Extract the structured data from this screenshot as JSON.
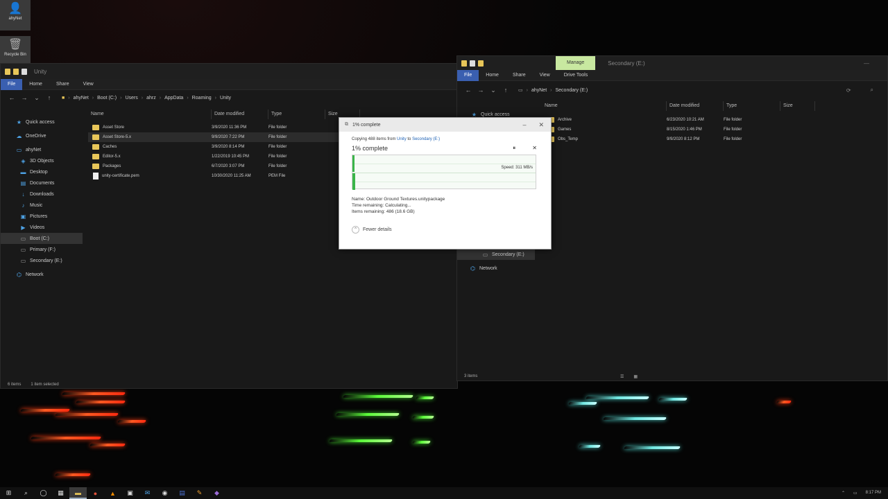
{
  "desktop": {
    "icons": [
      {
        "label": "ahyNet",
        "icon": "user-folder-icon"
      },
      {
        "label": "Recycle Bin",
        "icon": "recycle-bin-icon"
      }
    ]
  },
  "left_window": {
    "title": "Unity",
    "ribbon_tabs": [
      "File",
      "Home",
      "Share",
      "View"
    ],
    "breadcrumb": [
      "ahyNet",
      "Boot (C:)",
      "Users",
      "ahrz",
      "AppData",
      "Roaming",
      "Unity"
    ],
    "columns": [
      "Name",
      "Date modified",
      "Type",
      "Size"
    ],
    "nav": [
      {
        "label": "Quick access",
        "icon": "star"
      },
      {
        "label": "OneDrive",
        "icon": "cloud"
      },
      {
        "label": "ahyNet",
        "icon": "user"
      },
      {
        "label": "3D Objects",
        "icon": "cube"
      },
      {
        "label": "Desktop",
        "icon": "desktop"
      },
      {
        "label": "Documents",
        "icon": "doc"
      },
      {
        "label": "Downloads",
        "icon": "down"
      },
      {
        "label": "Music",
        "icon": "music"
      },
      {
        "label": "Pictures",
        "icon": "pic"
      },
      {
        "label": "Videos",
        "icon": "video"
      },
      {
        "label": "Boot (C:)",
        "icon": "drive"
      },
      {
        "label": "Primary (F:)",
        "icon": "drive"
      },
      {
        "label": "Secondary (E:)",
        "icon": "drive"
      },
      {
        "label": "Network",
        "icon": "network"
      }
    ],
    "files": [
      {
        "name": "Asset Store",
        "date": "3/9/2020 11:36 PM",
        "type": "File folder",
        "kind": "folder"
      },
      {
        "name": "Asset Store-5.x",
        "date": "9/9/2020 7:22 PM",
        "type": "File folder",
        "kind": "folder"
      },
      {
        "name": "Caches",
        "date": "3/9/2020 8:14 PM",
        "type": "File folder",
        "kind": "folder"
      },
      {
        "name": "Editor-5.x",
        "date": "1/22/2019 10:45 PM",
        "type": "File folder",
        "kind": "folder"
      },
      {
        "name": "Packages",
        "date": "6/7/2020 3:07 PM",
        "type": "File folder",
        "kind": "folder"
      },
      {
        "name": "unity-certificate.pem",
        "date": "10/30/2020 11:25 AM",
        "type": "PEM File",
        "kind": "pem"
      }
    ],
    "status": [
      "6 items",
      "1 item selected"
    ]
  },
  "right_window": {
    "manage_tab": "Manage",
    "title": "Secondary (E:)",
    "ribbon_tabs": [
      "File",
      "Home",
      "Share",
      "View",
      "Drive Tools"
    ],
    "breadcrumb": [
      "ahyNet",
      "Secondary (E:)"
    ],
    "columns": [
      "Name",
      "Date modified",
      "Type",
      "Size"
    ],
    "nav_top": "Quick access",
    "nav_bottom": [
      {
        "label": "Secondary (E:)",
        "icon": "drive"
      },
      {
        "label": "Network",
        "icon": "network"
      }
    ],
    "files": [
      {
        "name": "Archive",
        "date": "6/23/2020 10:21 AM",
        "type": "File folder"
      },
      {
        "name": "Games",
        "date": "8/15/2020 1:46 PM",
        "type": "File folder"
      },
      {
        "name": "Obs_Temp",
        "date": "9/9/2020 8:12 PM",
        "type": "File folder"
      }
    ],
    "status": "3 items"
  },
  "copy_dialog": {
    "title": "1% complete",
    "copying_prefix": "Copying 488 items from",
    "from": "Unity",
    "to_word": "to",
    "to": "Secondary (E:)",
    "percent_text": "1% complete",
    "progress": 0.01,
    "speed": "Speed: 311 MB/s",
    "name_line": "Name:  Outdoor Ground Textures.unitypackage",
    "time_line": "Time remaining:  Calculating...",
    "items_line": "Items remaining:  486 (18.6 GB)",
    "fewer_details": "Fewer details"
  },
  "taskbar": {
    "time": "8:17 PM"
  }
}
